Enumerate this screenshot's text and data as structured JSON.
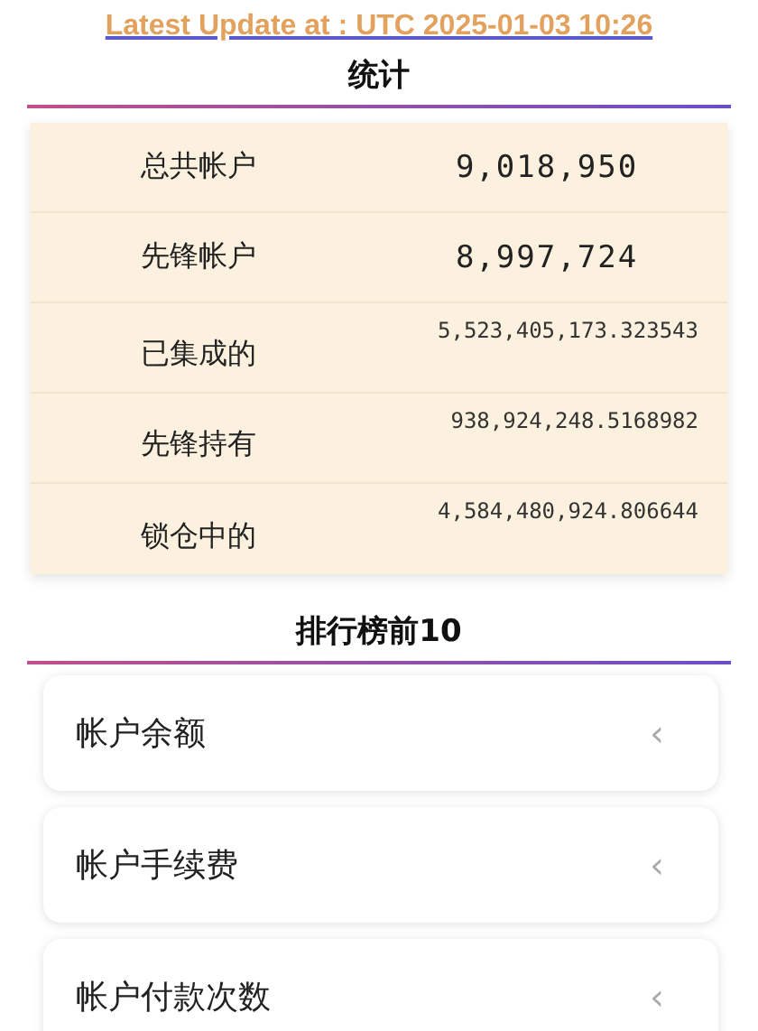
{
  "update_link": "Latest Update at : UTC 2025-01-03 10:26",
  "stats": {
    "title": "统计",
    "rows": [
      {
        "label": "总共帐户",
        "value": "9,018,950",
        "kind": "large"
      },
      {
        "label": "先锋帐户",
        "value": "8,997,724",
        "kind": "large"
      },
      {
        "label": "已集成的",
        "value": "5,523,405,173.323543",
        "kind": "small"
      },
      {
        "label": "先锋持有",
        "value": "938,924,248.5168982",
        "kind": "small"
      },
      {
        "label": "锁仓中的",
        "value": "4,584,480,924.806644",
        "kind": "small"
      }
    ]
  },
  "ranking": {
    "title": "排行榜前10",
    "items": [
      {
        "label": "帐户余额",
        "icon": "‹"
      },
      {
        "label": "帐户手续费",
        "icon": "‹"
      },
      {
        "label": "帐户付款次数",
        "icon": "‹"
      }
    ]
  }
}
